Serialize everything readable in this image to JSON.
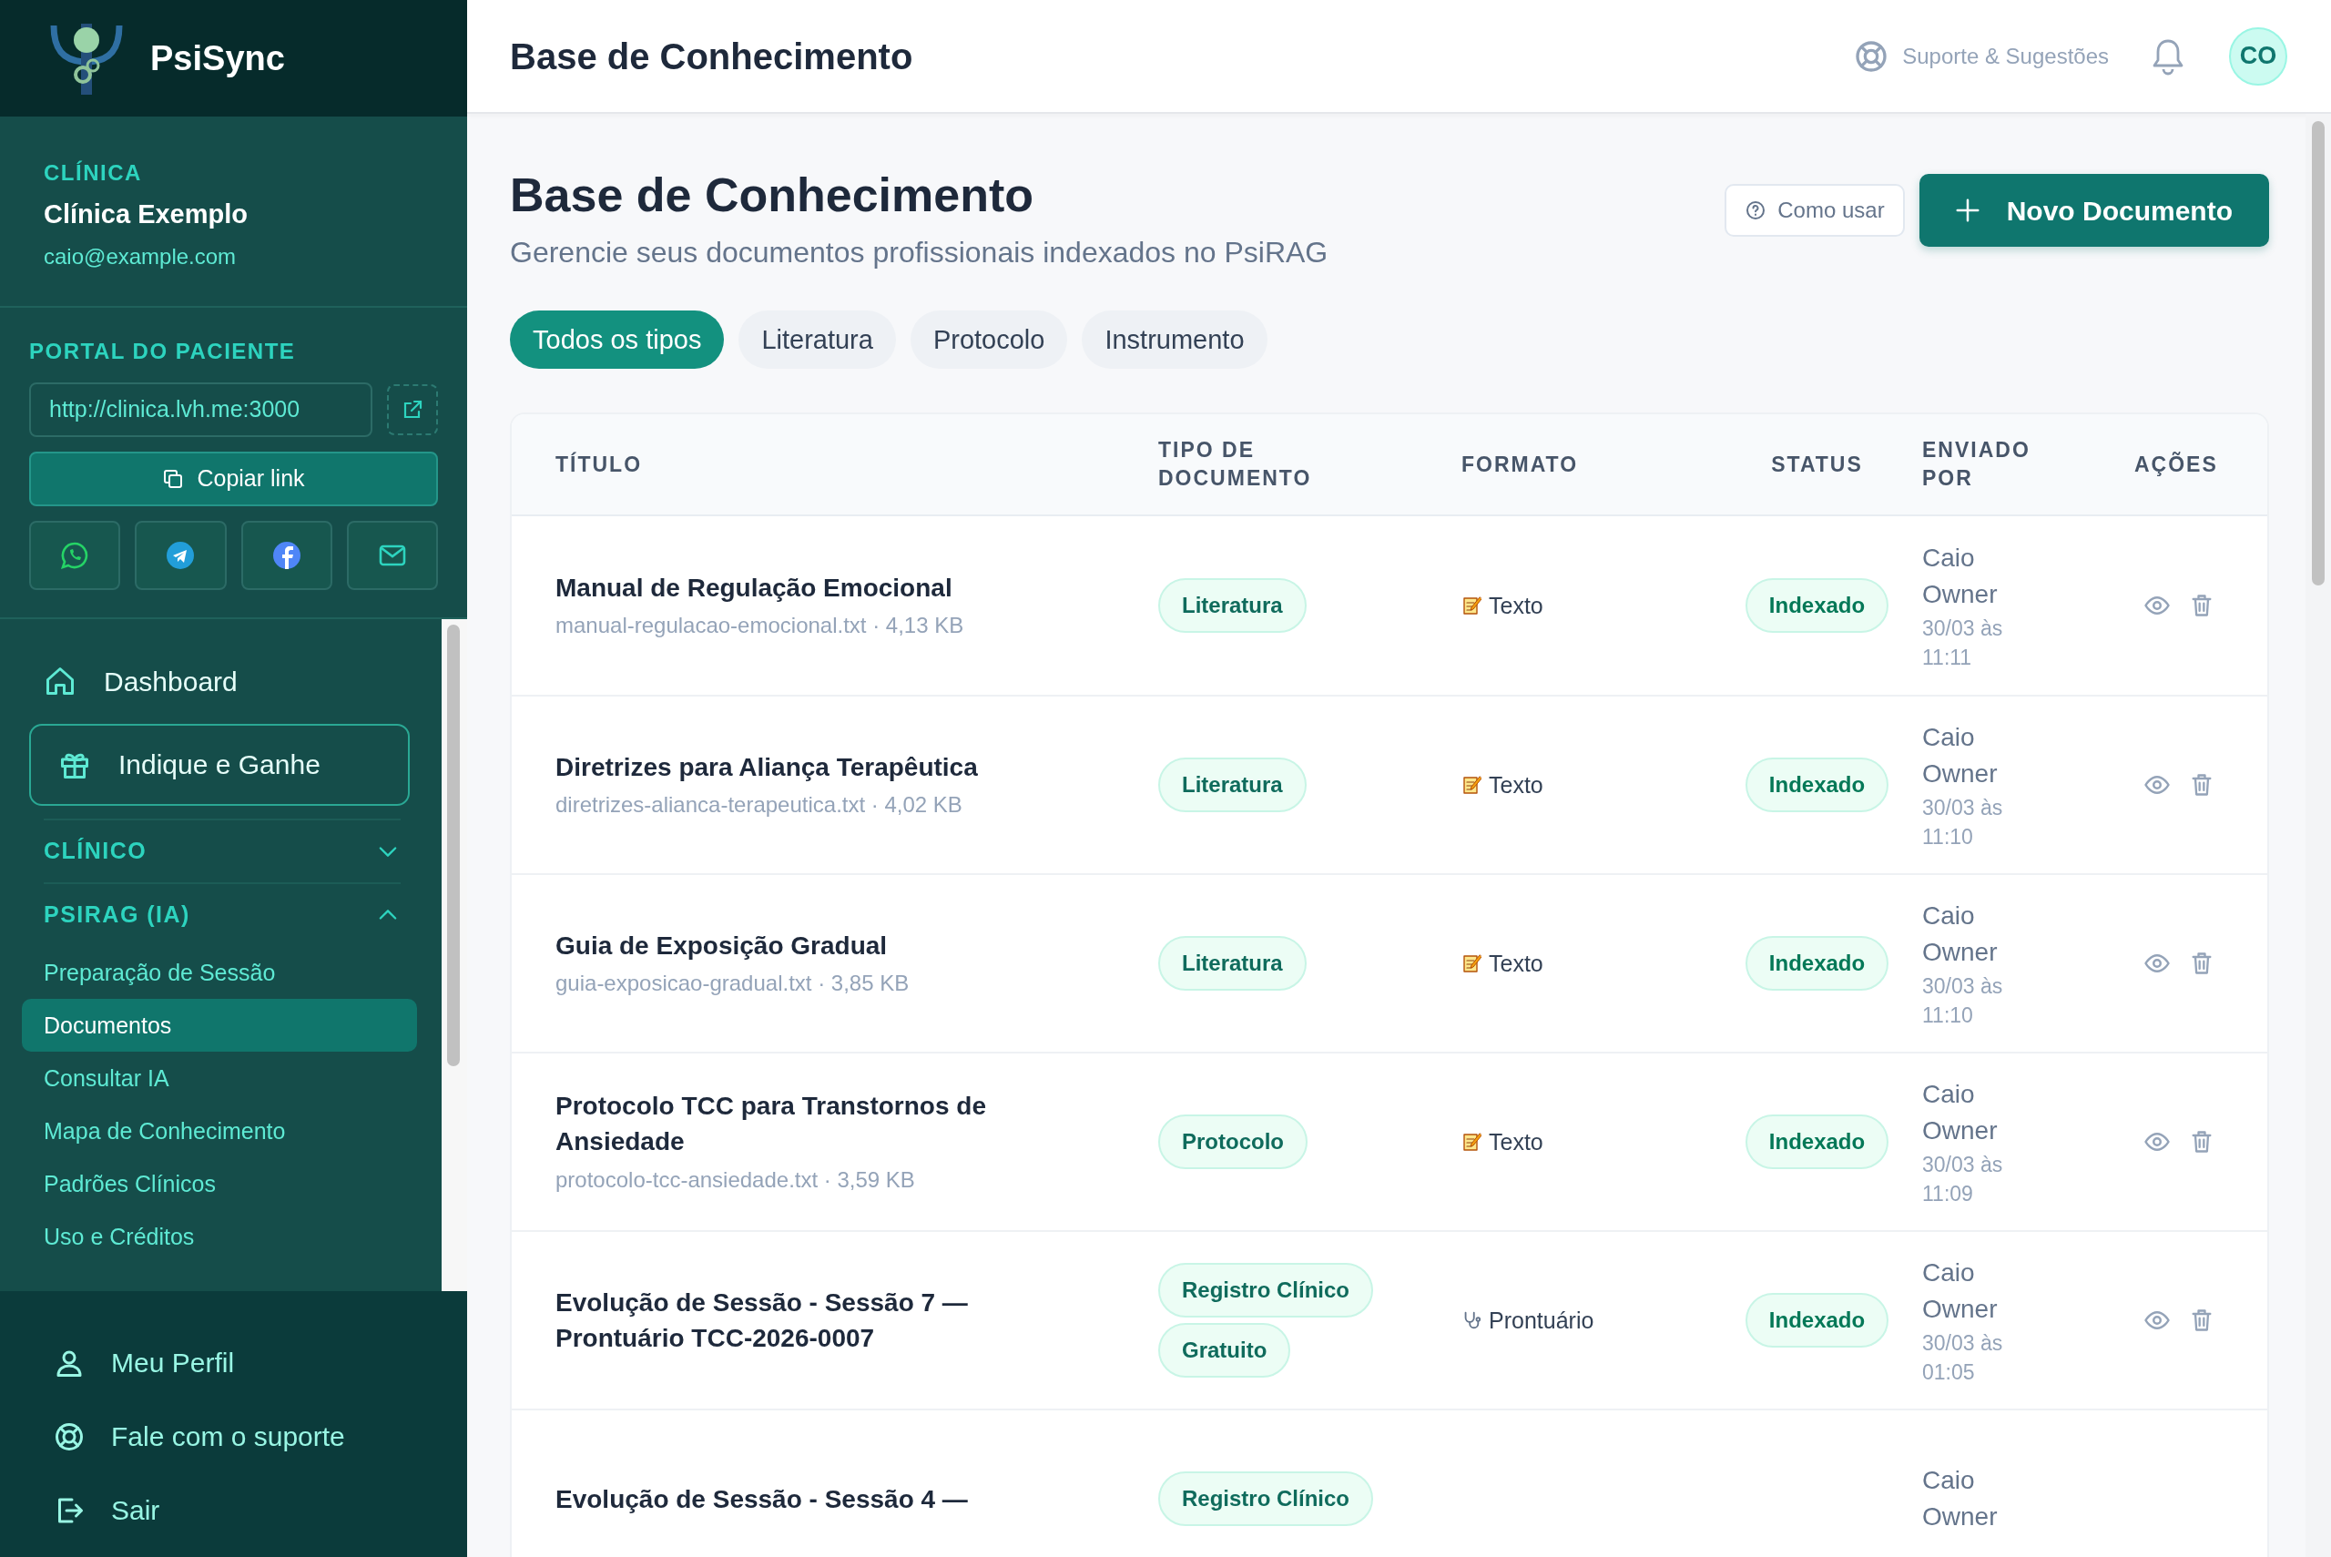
{
  "brand": {
    "name": "PsiSync"
  },
  "clinic": {
    "label": "CLÍNICA",
    "name": "Clínica Exemplo",
    "email": "caio@example.com"
  },
  "portal": {
    "label": "PORTAL DO PACIENTE",
    "url": "http://clinica.lvh.me:3000",
    "copy_button": "Copiar link"
  },
  "nav": [
    {
      "label": "Dashboard",
      "kind": "link"
    },
    {
      "label": "Indique e Ganhe",
      "kind": "promo"
    }
  ],
  "sections": [
    {
      "label": "CLÍNICO",
      "expanded": false
    },
    {
      "label": "PSIRAG (IA)",
      "expanded": true,
      "items": [
        {
          "label": "Preparação de Sessão",
          "selected": false
        },
        {
          "label": "Documentos",
          "selected": true
        },
        {
          "label": "Consultar IA",
          "selected": false
        },
        {
          "label": "Mapa de Conhecimento",
          "selected": false
        },
        {
          "label": "Padrões Clínicos",
          "selected": false
        },
        {
          "label": "Uso e Créditos",
          "selected": false
        }
      ]
    }
  ],
  "footer_nav": [
    {
      "label": "Meu Perfil"
    },
    {
      "label": "Fale com o suporte"
    },
    {
      "label": "Sair"
    }
  ],
  "header": {
    "title": "Base de Conhecimento",
    "support": "Suporte & Sugestões",
    "avatar": "CO"
  },
  "page": {
    "title": "Base de Conhecimento",
    "subtitle": "Gerencie seus documentos profissionais indexados no PsiRAG",
    "help_button": "Como usar",
    "new_button": "Novo Documento"
  },
  "filters": [
    {
      "label": "Todos os tipos",
      "selected": true
    },
    {
      "label": "Literatura",
      "selected": false
    },
    {
      "label": "Protocolo",
      "selected": false
    },
    {
      "label": "Instrumento",
      "selected": false
    }
  ],
  "table": {
    "columns": [
      "TÍTULO",
      "TIPO DE DOCUMENTO",
      "FORMATO",
      "STATUS",
      "ENVIADO POR",
      "AÇÕES"
    ],
    "rows": [
      {
        "title": "Manual de Regulação Emocional",
        "file": "manual-regulacao-emocional.txt · 4,13 KB",
        "types": [
          "Literatura"
        ],
        "format": {
          "kind": "text",
          "label": "Texto"
        },
        "status": "Indexado",
        "author": "Caio Owner",
        "date": "30/03 às 11:11"
      },
      {
        "title": "Diretrizes para Aliança Terapêutica",
        "file": "diretrizes-alianca-terapeutica.txt · 4,02 KB",
        "types": [
          "Literatura"
        ],
        "format": {
          "kind": "text",
          "label": "Texto"
        },
        "status": "Indexado",
        "author": "Caio Owner",
        "date": "30/03 às 11:10"
      },
      {
        "title": "Guia de Exposição Gradual",
        "file": "guia-exposicao-gradual.txt · 3,85 KB",
        "types": [
          "Literatura"
        ],
        "format": {
          "kind": "text",
          "label": "Texto"
        },
        "status": "Indexado",
        "author": "Caio Owner",
        "date": "30/03 às 11:10"
      },
      {
        "title": "Protocolo TCC para Transtornos de Ansiedade",
        "file": "protocolo-tcc-ansiedade.txt · 3,59 KB",
        "types": [
          "Protocolo"
        ],
        "format": {
          "kind": "text",
          "label": "Texto"
        },
        "status": "Indexado",
        "author": "Caio Owner",
        "date": "30/03 às 11:09"
      },
      {
        "title": "Evolução de Sessão - Sessão 7 — Prontuário TCC-2026-0007",
        "types": [
          "Registro Clínico",
          "Gratuito"
        ],
        "format": {
          "kind": "record",
          "label": "Prontuário"
        },
        "status": "Indexado",
        "author": "Caio Owner",
        "date": "30/03 às 01:05"
      },
      {
        "title": "Evolução de Sessão - Sessão 4 —",
        "types": [
          "Registro Clínico"
        ],
        "author": "Caio Owner"
      }
    ]
  }
}
